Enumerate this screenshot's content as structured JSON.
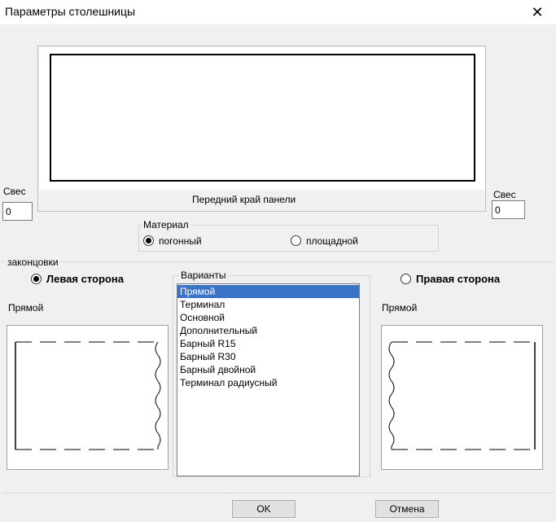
{
  "window": {
    "title": "Параметры столешницы"
  },
  "preview": {
    "front_edge_label": "Передний край панели"
  },
  "overhang_left": {
    "label": "Свес",
    "value": "0"
  },
  "overhang_right": {
    "label": "Свес",
    "value": "0"
  },
  "material": {
    "legend": "Материал",
    "options": [
      {
        "label": "погонный",
        "selected": true
      },
      {
        "label": "площадной",
        "selected": false
      }
    ]
  },
  "endings": {
    "legend": "законцовки",
    "left_side": {
      "label": "Левая сторона",
      "selected": true,
      "current_variant": "Прямой"
    },
    "right_side": {
      "label": "Правая сторона",
      "selected": false,
      "current_variant": "Прямой"
    }
  },
  "variants": {
    "legend": "Варианты",
    "items": [
      "Прямой",
      "Терминал",
      "Основной",
      "Дополнительный",
      "Барный R15",
      "Барный R30",
      "Барный двойной",
      "Терминал радиусный"
    ],
    "selected_index": 0
  },
  "buttons": {
    "ok": "OK",
    "cancel": "Отмена"
  }
}
